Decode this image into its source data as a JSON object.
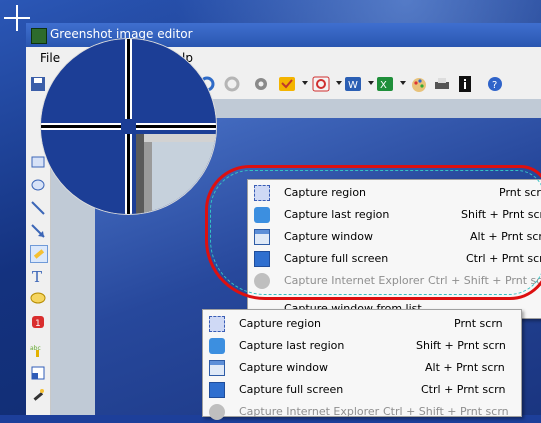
{
  "window": {
    "title": "Greenshot image editor"
  },
  "menubar": {
    "items": [
      "File",
      "lp"
    ]
  },
  "toolbar": {
    "icons": [
      "save-icon",
      "refresh-icon",
      "settings-icon",
      "outlook-icon",
      "office-icon",
      "word-icon",
      "excel-icon",
      "paint-icon",
      "printer-icon",
      "info-icon",
      "help-icon"
    ]
  },
  "sidetools": {
    "icons": [
      "rectangle-icon",
      "ellipse-icon",
      "line-icon",
      "arrow-icon",
      "highlight-icon",
      "text-icon",
      "speechbubble-icon",
      "counter-icon",
      "marker-icon",
      "crop-icon",
      "effects-icon"
    ]
  },
  "context_menu_back": {
    "items": [
      {
        "label": "Capture region",
        "shortcut": "Prnt scrn",
        "icon": "region-icon",
        "enabled": true
      },
      {
        "label": "Capture last region",
        "shortcut": "Shift + Prnt scrn",
        "icon": "last-region-icon",
        "enabled": true
      },
      {
        "label": "Capture window",
        "shortcut": "Alt + Prnt scrn",
        "icon": "window-icon",
        "enabled": true
      },
      {
        "label": "Capture full screen",
        "shortcut": "Ctrl + Prnt scrn",
        "icon": "full-screen-icon",
        "enabled": true
      },
      {
        "label": "Capture Internet Explorer",
        "shortcut": "Ctrl + Shift + Prnt scrn",
        "icon": "ie-icon",
        "enabled": false
      },
      {
        "label": "Capture window from list",
        "shortcut": "",
        "icon": "",
        "enabled": true
      }
    ]
  },
  "context_menu_front": {
    "items": [
      {
        "label": "Capture region",
        "shortcut": "Prnt scrn",
        "icon": "region-icon",
        "enabled": true
      },
      {
        "label": "Capture last region",
        "shortcut": "Shift + Prnt scrn",
        "icon": "last-region-icon",
        "enabled": true
      },
      {
        "label": "Capture window",
        "shortcut": "Alt + Prnt scrn",
        "icon": "window-icon",
        "enabled": true
      },
      {
        "label": "Capture full screen",
        "shortcut": "Ctrl + Prnt scrn",
        "icon": "full-screen-icon",
        "enabled": true
      },
      {
        "label": "Capture Internet Explorer",
        "shortcut": "Ctrl + Shift + Prnt scrn",
        "icon": "ie-icon",
        "enabled": false
      }
    ]
  },
  "colors": {
    "annotation_line": "#dd1010",
    "annotation_dash": "#33c3c3",
    "title_bar": "#2f5cb8"
  }
}
